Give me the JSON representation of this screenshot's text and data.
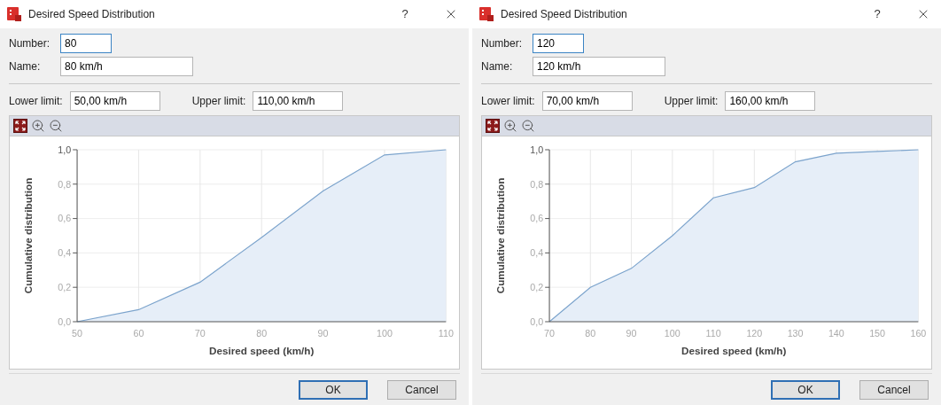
{
  "dialogs": [
    {
      "window": {
        "title": "Desired Speed Distribution",
        "help": "?"
      },
      "number": {
        "label": "Number:",
        "value": "80"
      },
      "name": {
        "label": "Name:",
        "value": "80 km/h"
      },
      "lower_limit": {
        "label": "Lower limit:",
        "value": "50,00 km/h"
      },
      "upper_limit": {
        "label": "Upper limit:",
        "value": "110,00 km/h"
      },
      "chart_data": {
        "type": "area",
        "xlabel": "Desired speed (km/h)",
        "ylabel": "Cumulative distribution",
        "x": [
          50,
          60,
          70,
          80,
          90,
          100,
          110
        ],
        "grid": true,
        "series": [
          {
            "color": "#7ba3cc",
            "values": [
              0,
              0.07,
              0.23,
              0.49,
              0.76,
              0.97,
              1.0
            ]
          }
        ],
        "xlim": [
          50,
          110
        ],
        "ylim": [
          0,
          1
        ],
        "xticks": [
          50,
          60,
          70,
          80,
          90,
          100,
          110
        ],
        "yticks": [
          {
            "value": 0,
            "label": "0,0"
          },
          {
            "value": 0.2,
            "label": "0,2"
          },
          {
            "value": 0.4,
            "label": "0,4"
          },
          {
            "value": 0.6,
            "label": "0,6"
          },
          {
            "value": 0.8,
            "label": "0,8"
          },
          {
            "value": 1,
            "label": "1,0"
          }
        ]
      },
      "buttons": [
        {
          "label": "OK",
          "default": true
        },
        {
          "label": "Cancel",
          "default": false
        }
      ]
    },
    {
      "window": {
        "title": "Desired Speed Distribution",
        "help": "?"
      },
      "number": {
        "label": "Number:",
        "value": "120"
      },
      "name": {
        "label": "Name:",
        "value": "120 km/h"
      },
      "lower_limit": {
        "label": "Lower limit:",
        "value": "70,00 km/h"
      },
      "upper_limit": {
        "label": "Upper limit:",
        "value": "160,00 km/h"
      },
      "chart_data": {
        "type": "area",
        "xlabel": "Desired speed (km/h)",
        "ylabel": "Cumulative distribution",
        "x": [
          70,
          80,
          90,
          100,
          110,
          120,
          130,
          140,
          150,
          160
        ],
        "grid": true,
        "series": [
          {
            "color": "#7ba3cc",
            "values": [
              0,
              0.2,
              0.31,
              0.5,
              0.72,
              0.78,
              0.93,
              0.98,
              0.99,
              1.0
            ]
          }
        ],
        "xlim": [
          70,
          160
        ],
        "ylim": [
          0,
          1
        ],
        "xticks": [
          70,
          80,
          90,
          100,
          110,
          120,
          130,
          140,
          150,
          160
        ],
        "yticks": [
          {
            "value": 0,
            "label": "0,0"
          },
          {
            "value": 0.2,
            "label": "0,2"
          },
          {
            "value": 0.4,
            "label": "0,4"
          },
          {
            "value": 0.6,
            "label": "0,6"
          },
          {
            "value": 0.8,
            "label": "0,8"
          },
          {
            "value": 1,
            "label": "1,0"
          }
        ]
      },
      "buttons": [
        {
          "label": "OK",
          "default": true
        },
        {
          "label": "Cancel",
          "default": false
        }
      ]
    }
  ]
}
